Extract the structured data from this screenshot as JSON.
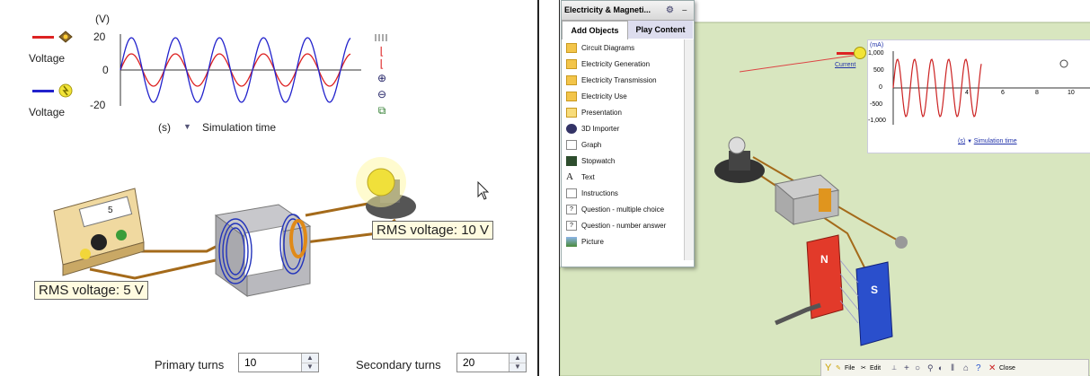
{
  "left": {
    "legend": [
      {
        "label": "Voltage",
        "color": "#dd2222"
      },
      {
        "label": "Voltage",
        "color": "#2222cc"
      }
    ],
    "graph": {
      "y_unit": "(V)",
      "x_unit": "(s)",
      "x_caption": "Simulation time",
      "ticks": [
        "20",
        "0",
        "-20"
      ]
    },
    "zoom_tools": [
      "zoom-in-icon",
      "zoom-out-icon",
      "crop-icon"
    ],
    "primary_rms": "RMS voltage: 5 V",
    "secondary_rms": "RMS voltage: 10 V",
    "meter_value": "5",
    "primary_turns": {
      "label": "Primary turns",
      "value": "10"
    },
    "secondary_turns": {
      "label": "Secondary turns",
      "value": "20"
    }
  },
  "right": {
    "window_title": "Electricity & Magneti...",
    "tabs": [
      "Add Objects",
      "Play Content"
    ],
    "items": [
      {
        "label": "Circuit Diagrams",
        "icon": "folder-icon"
      },
      {
        "label": "Electricity Generation",
        "icon": "folder-icon"
      },
      {
        "label": "Electricity Transmission",
        "icon": "folder-icon"
      },
      {
        "label": "Electricity Use",
        "icon": "folder-icon"
      },
      {
        "label": "Presentation",
        "icon": "folder-open-icon"
      },
      {
        "label": "3D Importer",
        "icon": "importer-icon"
      },
      {
        "label": "Graph",
        "icon": "graph-icon"
      },
      {
        "label": "Stopwatch",
        "icon": "stopwatch-icon"
      },
      {
        "label": "Text",
        "icon": "text-icon"
      },
      {
        "label": "Instructions",
        "icon": "instructions-icon"
      },
      {
        "label": "Question - multiple choice",
        "icon": "question-icon"
      },
      {
        "label": "Question - number answer",
        "icon": "question-icon"
      },
      {
        "label": "Picture",
        "icon": "picture-icon"
      }
    ],
    "graph": {
      "series_label": "Current",
      "y_unit": "(mA)",
      "y_ticks": [
        "1,000",
        "500",
        "0",
        "-500",
        "-1,000"
      ],
      "x_ticks": [
        "4",
        "6",
        "8",
        "10"
      ],
      "x_unit": "(s)",
      "x_caption": "Simulation time"
    },
    "magnet_labels": [
      "N",
      "S"
    ],
    "toolbar": {
      "file": "File",
      "edit": "Edit",
      "close": "Close"
    }
  }
}
